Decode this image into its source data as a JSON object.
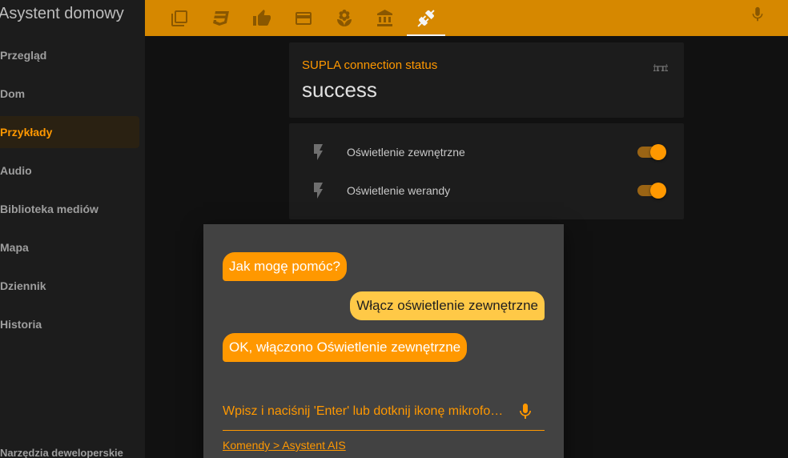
{
  "sidebar": {
    "title": "Asystent domowy",
    "items": [
      {
        "label": "Przegląd",
        "active": false
      },
      {
        "label": "Dom",
        "active": false
      },
      {
        "label": "Przykłady",
        "active": true
      },
      {
        "label": "Audio",
        "active": false
      },
      {
        "label": "Biblioteka mediów",
        "active": false
      },
      {
        "label": "Mapa",
        "active": false
      },
      {
        "label": "Dziennik",
        "active": false
      },
      {
        "label": "Historia",
        "active": false
      }
    ],
    "bottom_label": "Narzędzia deweloperskie"
  },
  "toolbar": {
    "tabs": [
      {
        "icon": "cards-icon"
      },
      {
        "icon": "css3-icon"
      },
      {
        "icon": "thumb-up-icon"
      },
      {
        "icon": "card-icon"
      },
      {
        "icon": "flower-icon"
      },
      {
        "icon": "bank-icon"
      },
      {
        "icon": "power-plug-icon",
        "active": true
      }
    ],
    "mic_icon": "microphone-icon"
  },
  "status_card": {
    "title": "SUPLA connection status",
    "value": "success",
    "icon": "bridge-icon"
  },
  "switches": [
    {
      "label": "Oświetlenie zewnętrzne",
      "on": true,
      "icon": "flash-icon"
    },
    {
      "label": "Oświetlenie werandy",
      "on": true,
      "icon": "flash-icon"
    }
  ],
  "dialog": {
    "messages": [
      {
        "from": "ais",
        "text": "Jak mogę pomóc?"
      },
      {
        "from": "user",
        "text": "Włącz oświetlenie zewnętrzne"
      },
      {
        "from": "ais",
        "text": "OK, włączono Oświetlenie zewnętrzne"
      }
    ],
    "input_placeholder": "Wpisz i naciśnij 'Enter' lub dotknij ikonę mikrofo…",
    "link_text": "Komendy > Asystent AIS"
  },
  "colors": {
    "accent": "#ff9800",
    "toolbar": "#d68800",
    "sidebar_bg": "#1c1c1c",
    "dialog_bg": "#424242"
  }
}
